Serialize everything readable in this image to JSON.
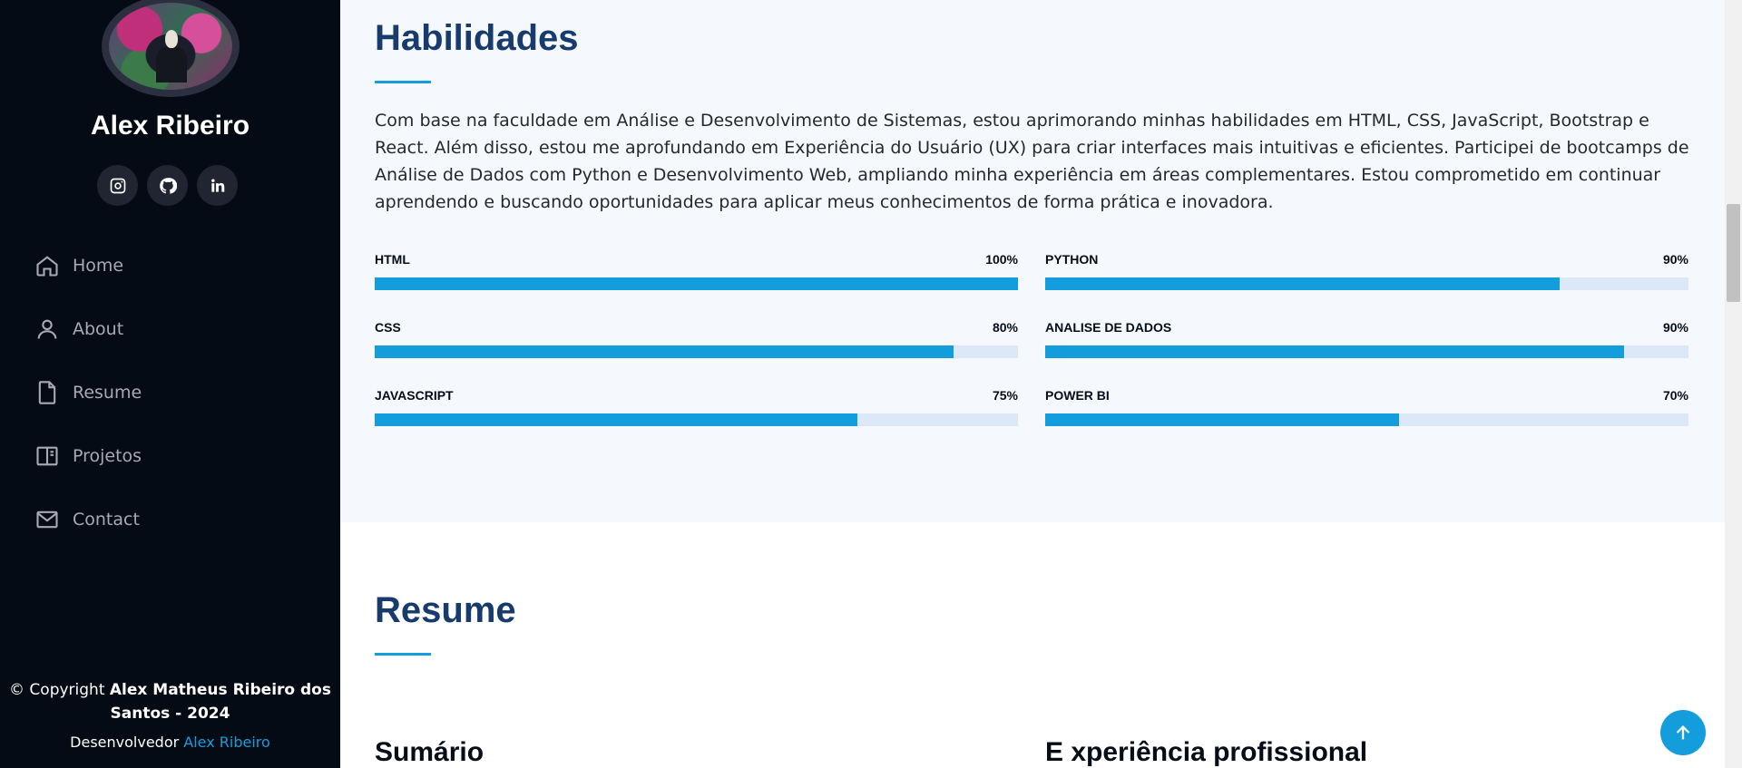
{
  "sidebar": {
    "name": "Alex Ribeiro",
    "socials": [
      {
        "icon": "instagram-icon"
      },
      {
        "icon": "github-icon"
      },
      {
        "icon": "linkedin-icon"
      }
    ],
    "nav": [
      {
        "label": "Home",
        "icon": "home-icon"
      },
      {
        "label": "About",
        "icon": "user-icon"
      },
      {
        "label": "Resume",
        "icon": "file-icon"
      },
      {
        "label": "Projetos",
        "icon": "book-icon"
      },
      {
        "label": "Contact",
        "icon": "envelope-icon"
      }
    ],
    "footer": {
      "copyright_prefix": "© Copyright ",
      "copyright_name": "Alex Matheus Ribeiro dos Santos - 2024",
      "credits_prefix": "Desenvolvedor ",
      "credits_link": "Alex Ribeiro"
    }
  },
  "skills": {
    "title": "Habilidades",
    "intro": "Com base na faculdade em Análise e Desenvolvimento de Sistemas, estou aprimorando minhas habilidades em HTML, CSS, JavaScript, Bootstrap e React. Além disso, estou me aprofundando em Experiência do Usuário (UX) para criar interfaces mais intuitivas e eficientes. Participei de bootcamps de Análise de Dados com Python e Desenvolvimento Web, ampliando minha experiência em áreas complementares. Estou comprometido em continuar aprendendo e buscando oportunidades para aplicar meus conhecimentos de forma prática e inovadora.",
    "items": [
      {
        "name": "HTML",
        "label": "100%",
        "value": 100
      },
      {
        "name": "PYTHON",
        "label": "90%",
        "value": 80
      },
      {
        "name": "CSS",
        "label": "80%",
        "value": 90
      },
      {
        "name": "ANALISE DE DADOS",
        "label": "90%",
        "value": 90
      },
      {
        "name": "JAVASCRIPT",
        "label": "75%",
        "value": 75
      },
      {
        "name": "POWER BI",
        "label": "70%",
        "value": 55
      }
    ]
  },
  "resume": {
    "title": "Resume",
    "summary_title": "Sumário",
    "experience_title": "E xperiência profissional"
  },
  "colors": {
    "accent": "#149ddd",
    "sidebar": "#040b14",
    "heading": "#173b6c"
  }
}
